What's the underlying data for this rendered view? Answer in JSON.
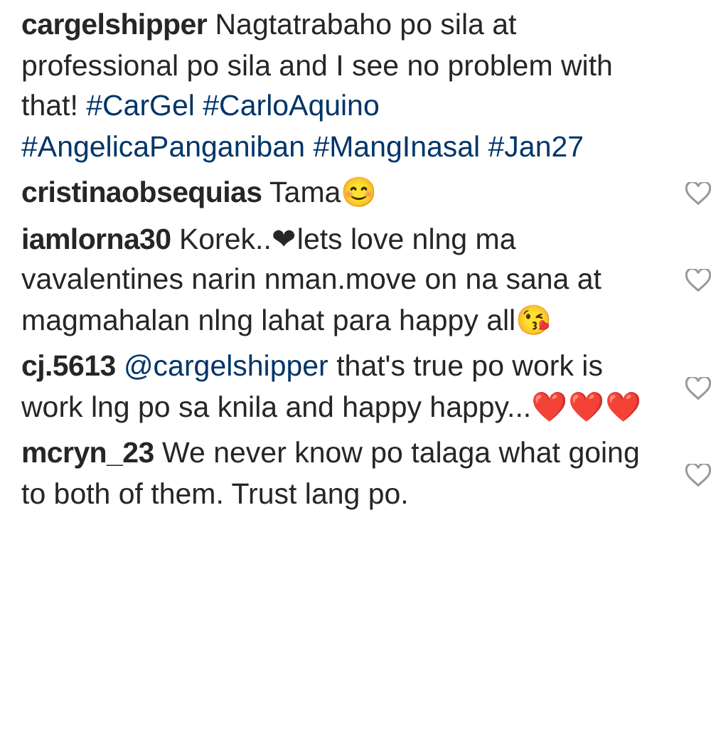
{
  "comments": [
    {
      "username": "cargelshipper",
      "segments": [
        {
          "kind": "text",
          "text": "Nagtatrabaho po sila at professional po sila and I see no problem with that!"
        },
        {
          "kind": "tag",
          "text": "#CarGel"
        },
        {
          "kind": "tag",
          "text": "#CarloAquino"
        },
        {
          "kind": "tag",
          "text": "#AngelicaPanganiban"
        },
        {
          "kind": "tag",
          "text": "#MangInasal"
        },
        {
          "kind": "tag",
          "text": "#Jan27"
        }
      ],
      "likeable": false
    },
    {
      "username": "cristinaobsequias",
      "segments": [
        {
          "kind": "text",
          "text": "Tama😊"
        }
      ],
      "likeable": true
    },
    {
      "username": "iamlorna30",
      "segments": [
        {
          "kind": "text",
          "text": "Korek..❤lets love nlng ma vavalentines narin nman.move on na sana at magmahalan nlng lahat para happy all😘"
        }
      ],
      "likeable": true
    },
    {
      "username": "cj.5613",
      "segments": [
        {
          "kind": "tag",
          "text": "@cargelshipper"
        },
        {
          "kind": "text",
          "text": "that's true po work is work lng po sa knila and happy happy...❤️❤️❤️"
        }
      ],
      "likeable": true
    },
    {
      "username": "mcryn_23",
      "segments": [
        {
          "kind": "text",
          "text": "We never know po talaga what going to both of them. Trust lang po."
        }
      ],
      "likeable": true
    }
  ]
}
